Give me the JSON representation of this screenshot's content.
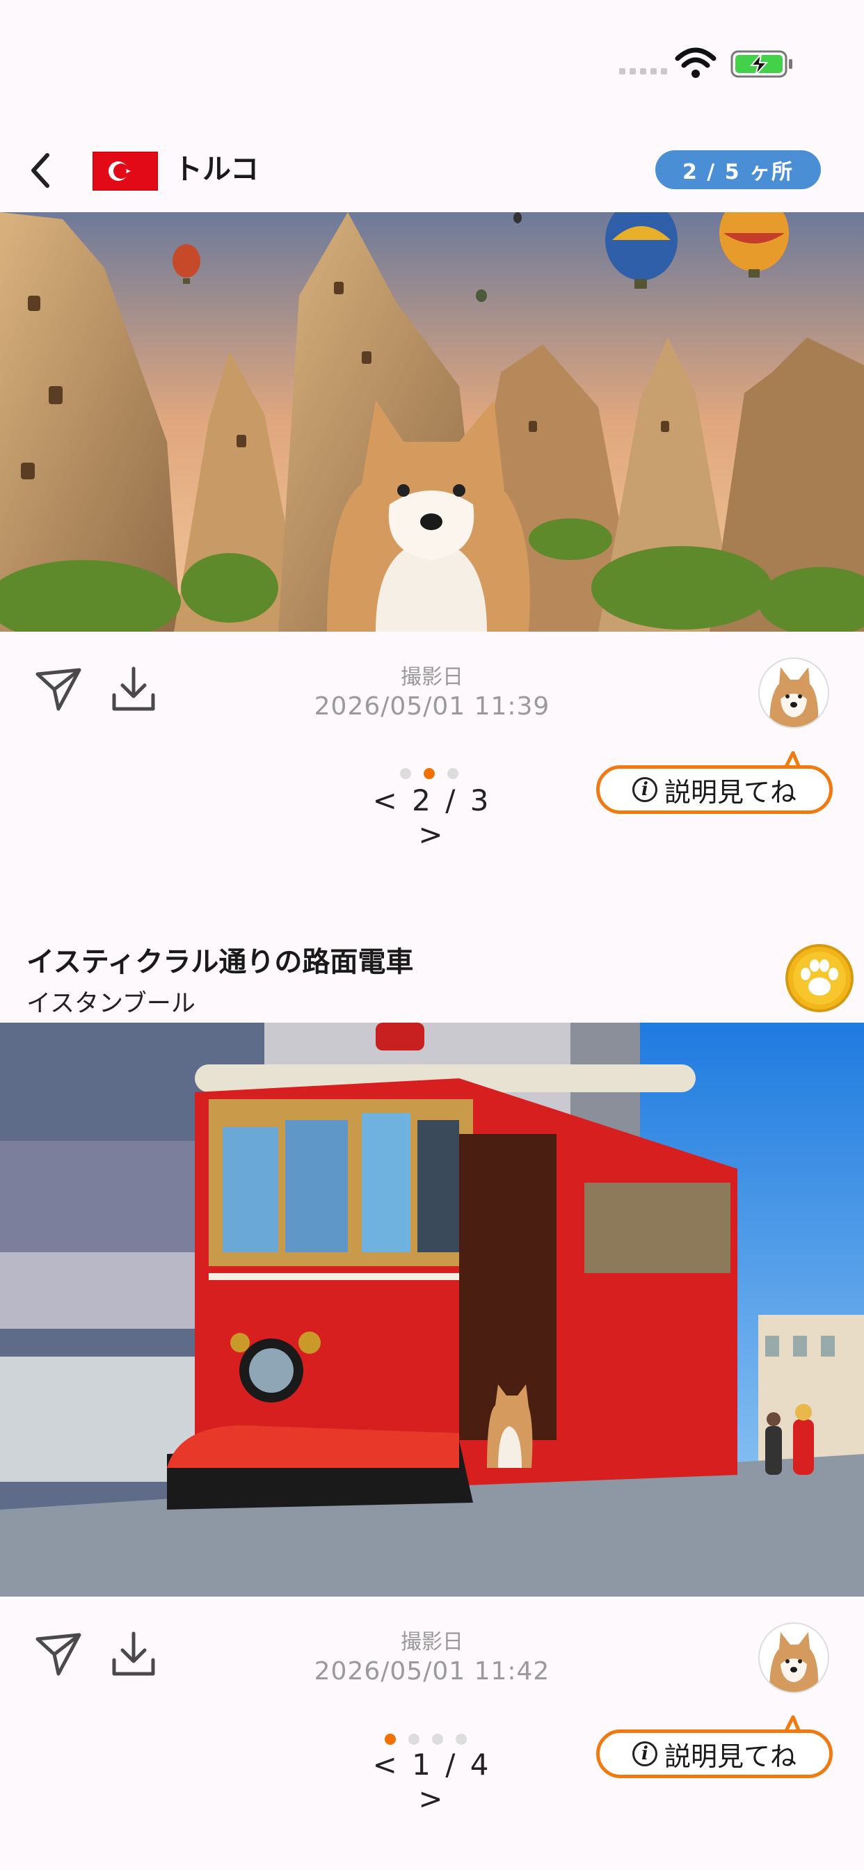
{
  "header": {
    "country": "トルコ",
    "counter": "2 / 5 ヶ所"
  },
  "cards": [
    {
      "shot_label": "撮影日",
      "shot_date": "2026/05/01 11:39",
      "pager": "< 2 / 3 >",
      "dots_total": 3,
      "dots_active": 2,
      "info_label": "説明見てね"
    },
    {
      "title": "イスティクラル通りの路面電車",
      "city": "イスタンブール",
      "shot_label": "撮影日",
      "shot_date": "2026/05/01 11:42",
      "pager": "< 1 / 4 >",
      "dots_total": 4,
      "dots_active": 1,
      "info_label": "説明見てね"
    }
  ],
  "colors": {
    "accent": "#f07000",
    "badge": "#4a8fd6",
    "flag": "#e30a17",
    "tram": "#d81f1f"
  },
  "icons": [
    "back-icon",
    "send-icon",
    "download-icon",
    "info-icon",
    "paw-icon",
    "wifi-icon",
    "battery-charging-icon"
  ]
}
